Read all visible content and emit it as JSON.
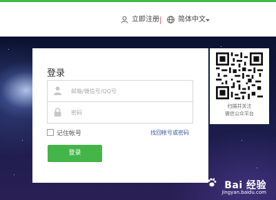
{
  "header": {
    "register_link": "立即注册",
    "language": "简体中文"
  },
  "login": {
    "title": "登录",
    "account_placeholder": "邮箱/微信号/QQ号",
    "password_placeholder": "密码",
    "remember_label": "记住帐号",
    "forgot_link": "找回帐号或密码",
    "submit_label": "登录"
  },
  "qr": {
    "caption_line1": "扫描并关注",
    "caption_line2": "微信公众平台"
  },
  "watermark": {
    "brand": "Bai 经验",
    "url": "jingyan.baidu.com"
  },
  "colors": {
    "accent_green": "#44b549",
    "top_stripe": "#3fb94b",
    "link_blue": "#3a5a9a",
    "separator_red": "#f06c6c"
  }
}
